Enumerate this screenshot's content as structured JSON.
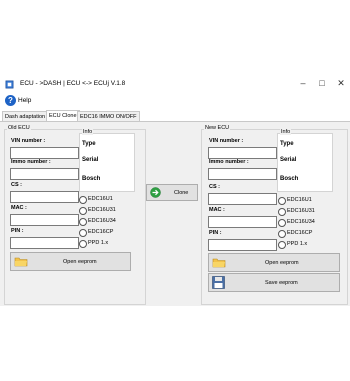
{
  "window": {
    "title": "ECU - >DASH | ECU <-> ECUj    V.1.8",
    "icon": "app-icon",
    "controls": [
      "minimize-icon",
      "maximize-icon",
      "close-icon"
    ]
  },
  "menu": {
    "help_label": "Help",
    "help_icon": "help-icon"
  },
  "tabs": [
    {
      "label": "Dash adaptation",
      "active": false
    },
    {
      "label": "ECU Clone",
      "active": true
    },
    {
      "label": "EDC16 IMMO ON/OFF",
      "active": false
    }
  ],
  "old_ecu": {
    "legend": "Old ECU",
    "vin_label": "VIN number :",
    "immo_label": "Immo number :",
    "cs_label": "CS :",
    "mac_label": "MAC :",
    "pin_label": "PIN :",
    "vin_value": "",
    "immo_value": "",
    "cs_value": "",
    "mac_value": "",
    "pin_value": "",
    "info": {
      "legend": "Info",
      "type": "Type",
      "serial": "Serial",
      "brand": "Bosch"
    },
    "radios": [
      "EDC16U1",
      "EDC16U31",
      "EDC16U34",
      "EDC16CP",
      "PPD 1.x"
    ],
    "open_button": "Open eeprom",
    "open_icon": "folder-icon"
  },
  "clone": {
    "label": "Clone",
    "icon": "arrow-right-icon",
    "accent": "#2ea043"
  },
  "new_ecu": {
    "legend": "New ECU",
    "vin_label": "VIN number :",
    "immo_label": "Immo number :",
    "cs_label": "CS :",
    "mac_label": "MAC :",
    "pin_label": "PIN :",
    "vin_value": "",
    "immo_value": "",
    "cs_value": "",
    "mac_value": "",
    "pin_value": "",
    "info": {
      "legend": "Info",
      "type": "Type",
      "serial": "Serial",
      "brand": "Bosch"
    },
    "radios": [
      "EDC16U1",
      "EDC16U31",
      "EDC16U34",
      "EDC16CP",
      "PPD 1.x"
    ],
    "open_button": "Open eeprom",
    "open_icon": "folder-icon",
    "save_button": "Save eeprom",
    "save_icon": "floppy-disk-icon"
  }
}
